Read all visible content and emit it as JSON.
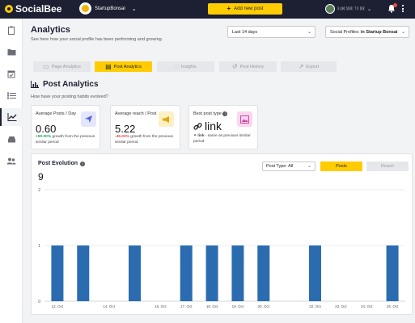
{
  "topbar": {
    "logo_text": "SocialBee",
    "brand_name": "StartupBonsai",
    "add_post_label": "Add new post",
    "user_name": "ᚱᛟᛞ ᚢᛞᚱ ᛏᚱ ᛞᚱ"
  },
  "header": {
    "title": "Analytics",
    "subtitle": "See here how your social profile has been performing and growing.",
    "date_range": "Last 14 days",
    "profiles_prefix": "Social Profiles: ",
    "profiles_value": "in Startup Bonsai"
  },
  "tabs": [
    {
      "label": "Page Analytics",
      "active": false
    },
    {
      "label": "Post Analytics",
      "active": true
    },
    {
      "label": "Insights",
      "active": false
    },
    {
      "label": "Post History",
      "active": false
    },
    {
      "label": "Export",
      "active": false
    }
  ],
  "section": {
    "title": "Post Analytics",
    "subtitle": "How have your posting habits evolved?"
  },
  "cards": {
    "avg_posts": {
      "label": "Average Posts / Day",
      "value": "0.60",
      "change": "+50.00%",
      "note": " growth from the previous similar period"
    },
    "avg_reach": {
      "label": "Average reach / Post",
      "value": "5.22",
      "change": "-45.03%",
      "note": " growth from the previous similar period"
    },
    "best_type": {
      "label": "Best post type",
      "value": "link",
      "note_bold": "link",
      "note": " - same as previous similar period"
    }
  },
  "evolution": {
    "title": "Post Evolution",
    "total": "9",
    "post_type_label": "Post Type: All",
    "posts_button": "Posts",
    "reach_button": "Reach"
  },
  "colors": {
    "accent": "#ffcc00",
    "topbar": "#1d1f33",
    "bar": "#2b6cb0",
    "up": "#20a05a",
    "down": "#e4473c"
  },
  "chart_data": {
    "type": "bar",
    "title": "Post Evolution",
    "categories": [
      "12. Oct",
      "13. Oct",
      "14. Oct",
      "15. Oct",
      "16. Oct",
      "17. Oct",
      "18. Oct",
      "19. Oct",
      "20. Oct",
      "21. Oct",
      "22. Oct",
      "23. Oct",
      "24. Oct",
      "25. Oct"
    ],
    "series": [
      {
        "values": [
          1,
          1,
          0,
          1,
          0,
          1,
          1,
          1,
          1,
          0,
          1,
          0,
          0,
          1
        ]
      }
    ],
    "yticks": [
      0,
      1,
      2
    ],
    "ylim": [
      0,
      2
    ],
    "grid": true,
    "tick_labels_shown": [
      "12. Oct",
      "14. Oct",
      "16. Oct",
      "17. Oct",
      "18. Oct",
      "19. Oct",
      "20. Oct",
      "22. Oct",
      "23. Oct",
      "24. Oct",
      "25. Oct"
    ]
  }
}
